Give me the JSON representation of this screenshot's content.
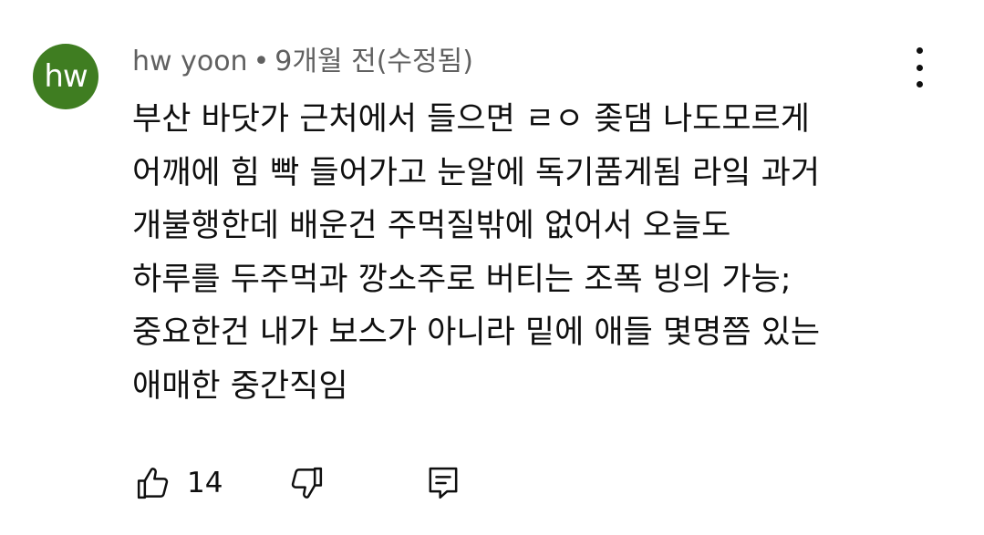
{
  "comment": {
    "avatar_text": "hw",
    "author": "hw yoon",
    "separator": "•",
    "time": "9개월 전(수정됨)",
    "body_lines": [
      "부산 바닷가 근처에서 들으면 ㄹㅇ 좆댐 나도모르게",
      "어깨에 힘 빡 들어가고 눈알에 독기품게됨 라잌 과거",
      "개불행한데 배운건 주먹질밖에 없어서 오늘도",
      "하루를 두주먹과 깡소주로 버티는 조폭 빙의 가능;",
      "중요한건 내가 보스가 아니라 밑에 애들 몇명쯤 있는",
      "애매한 중간직임"
    ],
    "like_count": "14",
    "icons": {
      "like": "thumbs-up-icon",
      "dislike": "thumbs-down-icon",
      "reply": "comment-reply-icon",
      "more": "more-vertical-icon"
    },
    "colors": {
      "avatar_bg": "#3f7d21",
      "meta_text": "#606060",
      "text": "#0f0f0f"
    }
  }
}
